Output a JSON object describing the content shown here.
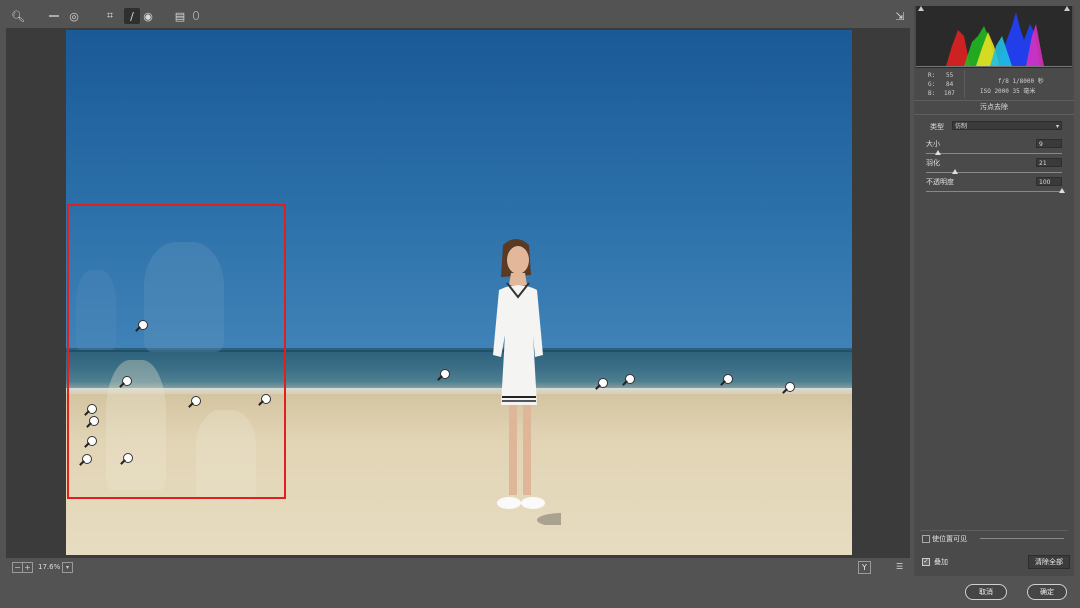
{
  "toolbar": {
    "tools": [
      "zoom-icon",
      "white-balance-icon",
      "color-sampler-icon",
      "crop-icon",
      "spot-removal-icon",
      "red-eye-icon",
      "preferences-icon",
      "rotate-icon"
    ],
    "active_tool": "spot-removal-icon"
  },
  "status": {
    "zoom": "17.6%"
  },
  "info": {
    "r_label": "R:",
    "r_value": "55",
    "g_label": "G:",
    "g_value": "84",
    "b_label": "B:",
    "b_value": "107",
    "exposure": "f/8   1/8000 秒",
    "iso": "ISO 2000   35 毫米"
  },
  "panel": {
    "title": "污点去除",
    "type_label": "类型",
    "type_value": "仿制",
    "size_label": "大小",
    "size_value": "9",
    "size_level": 0.09,
    "feather_label": "羽化",
    "feather_value": "21",
    "feather_level": 0.21,
    "opacity_label": "不透明度",
    "opacity_value": "100",
    "opacity_level": 1.0,
    "visualize_label": "使位置可见",
    "overlay_label": "叠加",
    "clear_all_button": "清除全部",
    "cancel_button": "取消",
    "ok_button": "确定"
  },
  "colors": {
    "selection": "#e0201e",
    "panel_bg": "#4a4a4a"
  }
}
